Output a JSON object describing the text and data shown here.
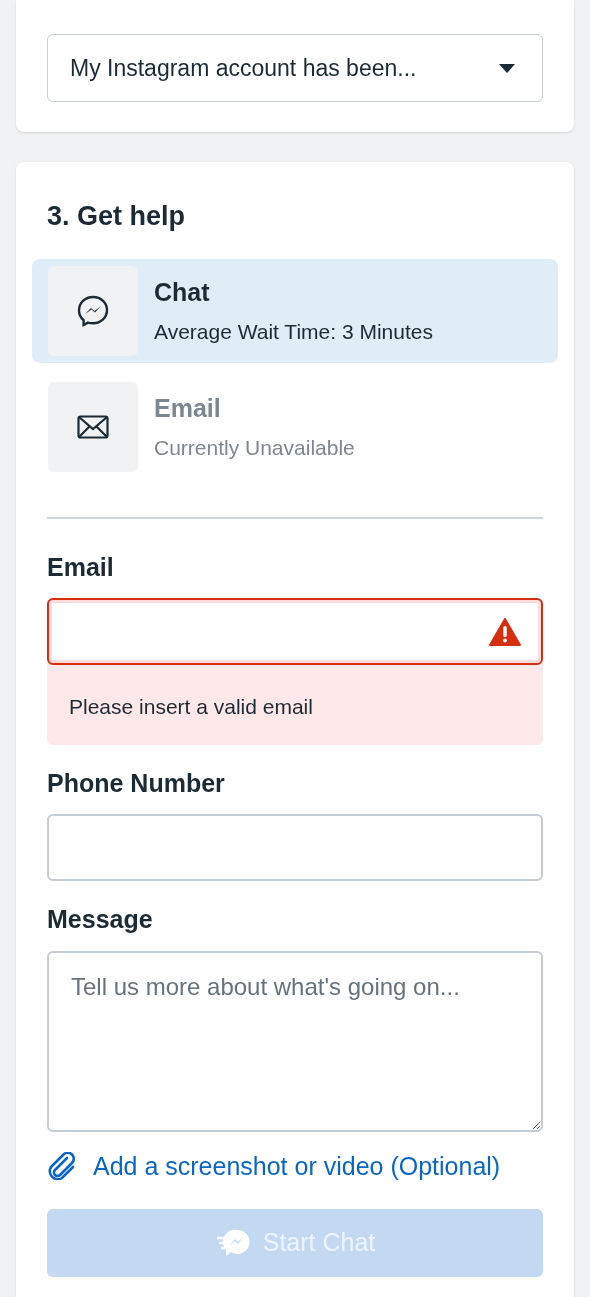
{
  "issue_select": {
    "value": "My Instagram account has been..."
  },
  "get_help": {
    "title": "3. Get help",
    "options": [
      {
        "kind": "chat",
        "title": "Chat",
        "subtitle": "Average Wait Time: 3 Minutes",
        "selected": true,
        "disabled": false
      },
      {
        "kind": "email",
        "title": "Email",
        "subtitle": "Currently Unavailable",
        "selected": false,
        "disabled": true
      }
    ],
    "fields": [
      {
        "kind": "input",
        "label": "Email",
        "error": "Please insert a valid email"
      },
      {
        "kind": "input",
        "label": "Phone Number"
      },
      {
        "kind": "textarea",
        "label": "Message",
        "placeholder": "Tell us more about what's going on..."
      }
    ],
    "attach_link": "Add a screenshot or video (Optional)",
    "submit": {
      "label": "Start Chat",
      "disabled": true
    }
  }
}
